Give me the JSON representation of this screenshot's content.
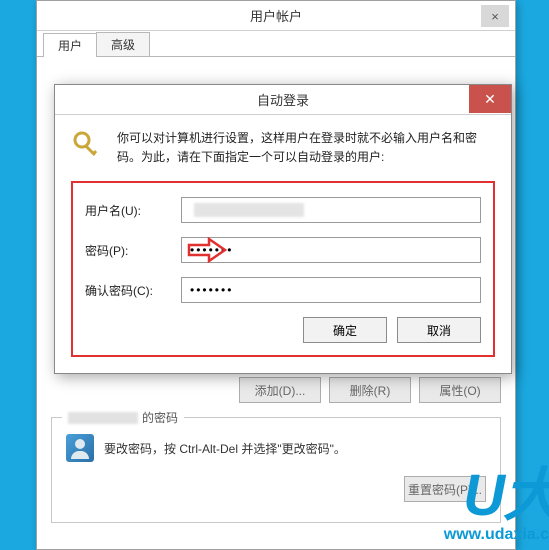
{
  "mainWindow": {
    "title": "用户帐户",
    "tabs": [
      {
        "label": "用户",
        "active": true
      },
      {
        "label": "高级",
        "active": false
      }
    ],
    "buttons": {
      "add": "添加(D)...",
      "remove": "删除(R)",
      "properties": "属性(O)"
    },
    "passwordGroup": {
      "legendSuffix": "的密码",
      "text": "要改密码，按 Ctrl-Alt-Del 并选择\"更改密码\"。",
      "resetBtn": "重置密码(P)..."
    }
  },
  "dialog": {
    "title": "自动登录",
    "description": "你可以对计算机进行设置，这样用户在登录时就不必输入用户名和密码。为此，请在下面指定一个可以自动登录的用户:",
    "fields": {
      "usernameLabel": "用户名(U):",
      "usernameValue": "",
      "passwordLabel": "密码(P):",
      "passwordValue": "•••••••",
      "confirmLabel": "确认密码(C):",
      "confirmValue": "•••••••"
    },
    "buttons": {
      "ok": "确定",
      "cancel": "取消"
    }
  },
  "watermark": {
    "brand": "U大",
    "url": "www.udaxia.c"
  }
}
